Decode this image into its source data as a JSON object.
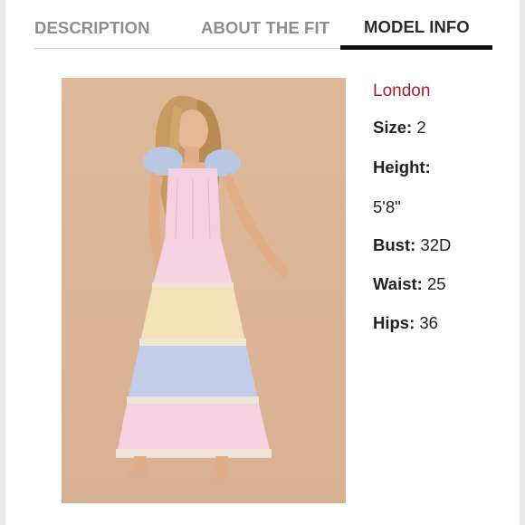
{
  "tabs": [
    {
      "label": "DESCRIPTION"
    },
    {
      "label": "ABOUT THE FIT"
    },
    {
      "label": "MODEL INFO"
    }
  ],
  "active_tab": "MODEL INFO",
  "model_info": {
    "city": "London",
    "size_label": "Size:",
    "size_value": "2",
    "height_label": "Height:",
    "height_value": "5'8\"",
    "bust_label": "Bust:",
    "bust_value": "32D",
    "waist_label": "Waist:",
    "waist_value": "25",
    "hips_label": "Hips:",
    "hips_value": "36"
  },
  "colors": {
    "accent_city": "#a8202f",
    "active_tab_underline": "#111111",
    "inactive_tab_text": "#8e8e8e",
    "photo_background": "#dcb597"
  },
  "photo": {
    "subject": "model in pastel tiered maxi dress"
  }
}
